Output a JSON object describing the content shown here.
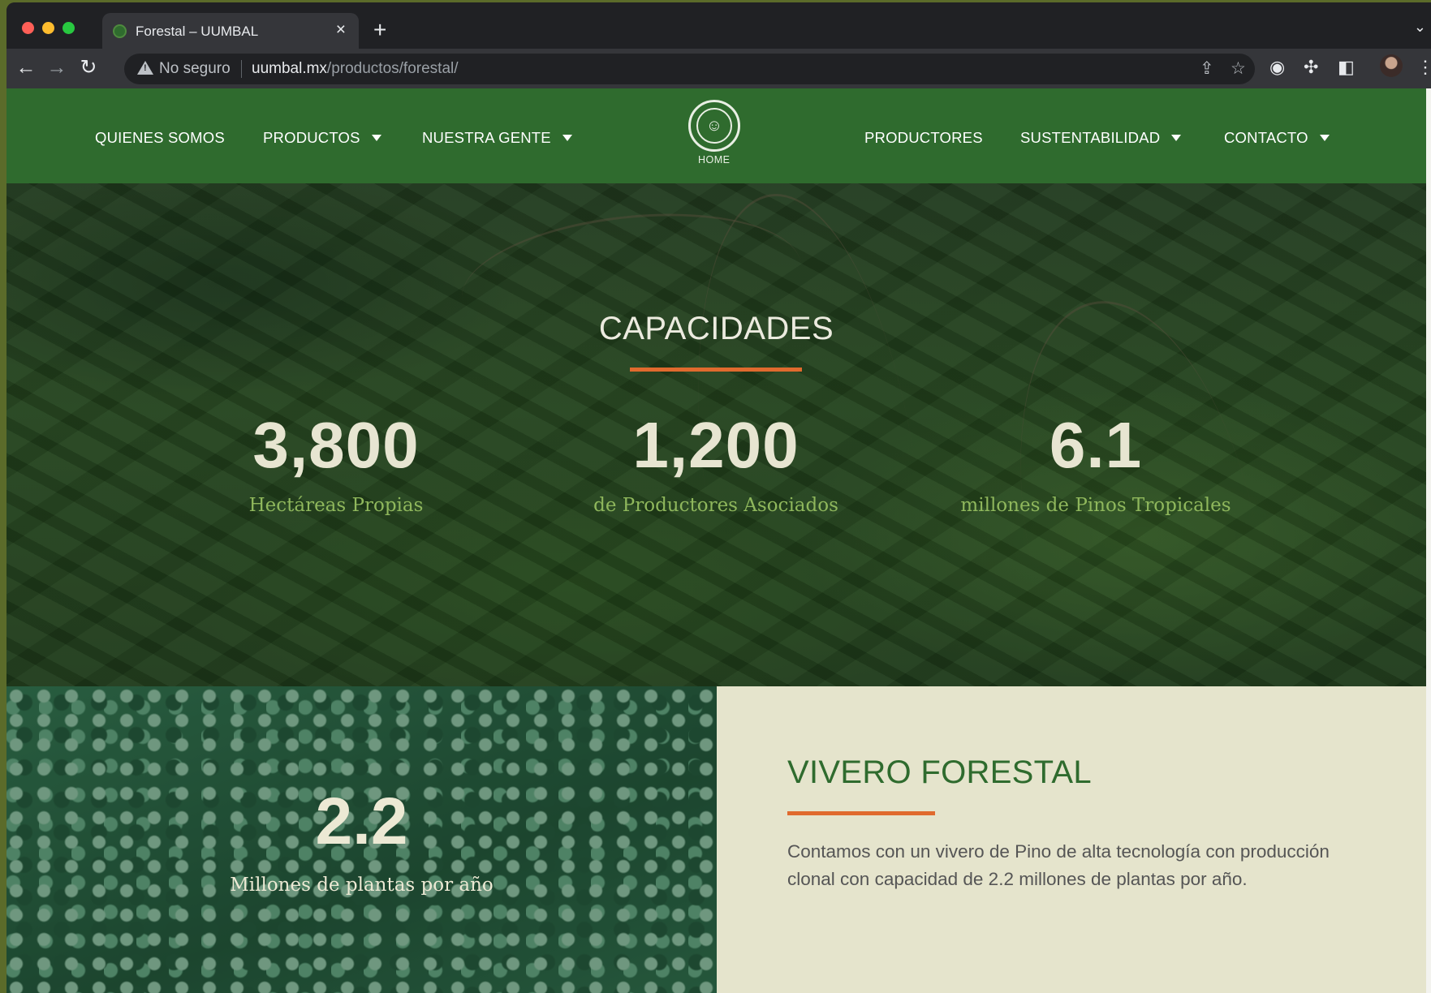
{
  "browser": {
    "tab_title": "Forestal – UUMBAL",
    "tab_close": "×",
    "new_tab": "+",
    "security_label": "No seguro",
    "url_host": "uumbal.mx",
    "url_path": "/productos/forestal/"
  },
  "nav": {
    "left": [
      "QUIENES SOMOS",
      "PRODUCTOS",
      "NUESTRA GENTE"
    ],
    "home_label": "HOME",
    "right": [
      "PRODUCTORES",
      "SUSTENTABILIDAD",
      "CONTACTO"
    ]
  },
  "capacidades": {
    "title": "CAPACIDADES",
    "stats": [
      {
        "value": "3,800",
        "label": "Hectáreas Propias"
      },
      {
        "value": "1,200",
        "label": "de Productores Asociados"
      },
      {
        "value": "6.1",
        "label": "millones de Pinos Tropicales"
      }
    ]
  },
  "vivero": {
    "number": "2.2",
    "number_label": "Millones de plantas por año",
    "title": "VIVERO FORESTAL",
    "description": "Contamos con un vivero de Pino de alta tecnología con producción clonal con capacidad de 2.2 millones de plantas por año."
  },
  "colors": {
    "nav_green": "#2f6b2e",
    "accent_orange": "#e06a2e",
    "stat_label_green": "#8fb75c",
    "panel_beige": "#e5e4cc"
  },
  "icons": [
    "back-arrow-icon",
    "forward-arrow-icon",
    "reload-icon",
    "warning-icon",
    "share-icon",
    "star-icon",
    "camera-icon",
    "puzzle-icon",
    "sidepanel-icon",
    "kebab-menu-icon",
    "dropdown-caret-icon",
    "logo-glyph-icon"
  ]
}
